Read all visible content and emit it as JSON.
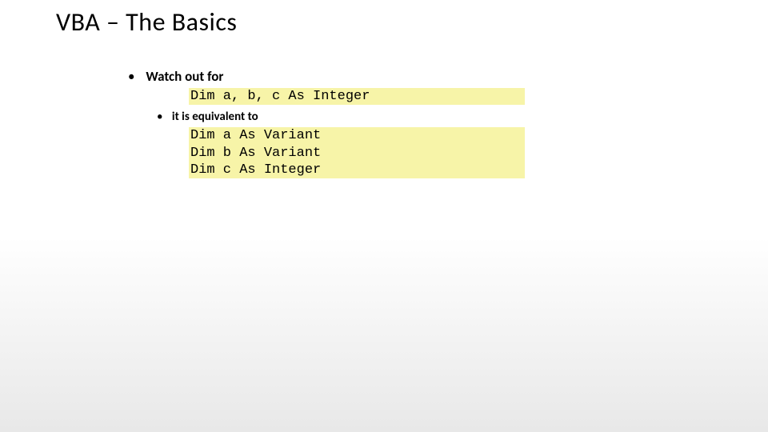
{
  "slide": {
    "title": "VBA – The Basics",
    "bullets": {
      "b1": "Watch out for",
      "code1": "Dim a, b, c As Integer",
      "b2": "it is equivalent to",
      "code2": "Dim a As Variant\nDim b As Variant\nDim c As Integer"
    }
  }
}
